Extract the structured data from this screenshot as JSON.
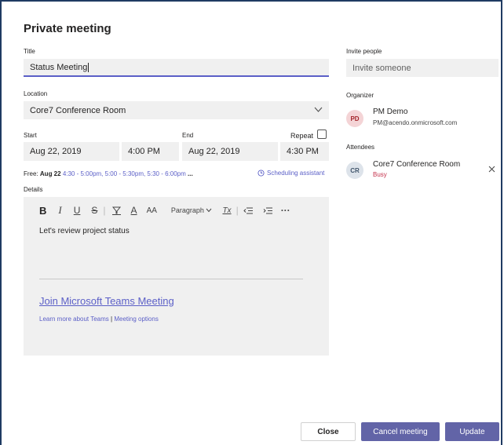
{
  "dialog": {
    "title": "Private meeting"
  },
  "form": {
    "title_label": "Title",
    "title_value": "Status Meeting",
    "location_label": "Location",
    "location_value": "Core7 Conference Room",
    "start_label": "Start",
    "start_date": "Aug 22, 2019",
    "start_time": "4:00 PM",
    "end_label": "End",
    "end_date": "Aug 22, 2019",
    "end_time": "4:30 PM",
    "repeat_label": "Repeat",
    "free_prefix": "Free:",
    "free_date": "Aug 22",
    "free_slots": "4:30 - 5:00pm,  5:00 - 5:30pm,  5:30 - 6:00pm",
    "free_more": "...",
    "scheduling_label": "Scheduling assistant",
    "details_label": "Details"
  },
  "editor": {
    "paragraph_label": "Paragraph",
    "body_text": "Let's review project status",
    "join_link": "Join Microsoft Teams Meeting",
    "learn_more": "Learn more about Teams",
    "separator": "|",
    "meeting_options": "Meeting options",
    "toolbar": {
      "bold": "B",
      "italic": "I",
      "underline": "U",
      "strike": "S",
      "font_color": "A",
      "font_size": "AA",
      "clear": "Tx",
      "more": "···"
    }
  },
  "invite": {
    "label": "Invite people",
    "placeholder": "Invite someone"
  },
  "organizer": {
    "label": "Organizer",
    "initials": "PD",
    "name": "PM Demo",
    "email": "PM@acendo.onmicrosoft.com"
  },
  "attendees": {
    "label": "Attendees",
    "items": [
      {
        "initials": "CR",
        "name": "Core7 Conference Room",
        "status": "Busy"
      }
    ]
  },
  "footer": {
    "close_label": "Close",
    "cancel_label": "Cancel meeting",
    "update_label": "Update"
  },
  "colors": {
    "accent": "#6264a7",
    "link": "#5b5fc7",
    "busy": "#c4314b",
    "frame": "#1f3b63"
  }
}
